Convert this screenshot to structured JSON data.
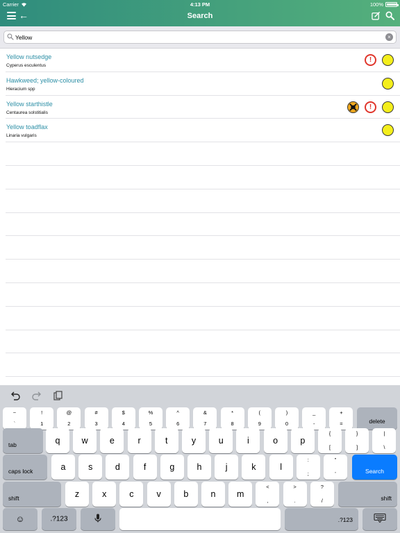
{
  "status": {
    "carrier": "Carrier",
    "time": "4:13 PM",
    "battery": "100%",
    "battery_level": 1.0
  },
  "nav": {
    "title": "Search",
    "menu_icon": "list-icon",
    "back_icon": "arrow-left-icon",
    "compose_icon": "compose-icon",
    "search_icon": "search-icon"
  },
  "search": {
    "value": "Yellow",
    "placeholder": ""
  },
  "results": [
    {
      "name": "Yellow nutsedge",
      "scientific": "Cyperus esculentus",
      "icons": [
        "alert",
        "yellow-dot"
      ]
    },
    {
      "name": "Hawkweed; yellow-coloured",
      "scientific": "Hieracium spp",
      "icons": [
        "yellow-dot"
      ]
    },
    {
      "name": "Yellow starthistle",
      "scientific": "Centaurea solstitialis",
      "icons": [
        "toxic",
        "alert",
        "yellow-dot"
      ]
    },
    {
      "name": "Yellow toadflax",
      "scientific": "Linaria vulgaris",
      "icons": [
        "yellow-dot"
      ]
    }
  ],
  "keyboard": {
    "row1": [
      {
        "top": "~",
        "bot": "`"
      },
      {
        "top": "!",
        "bot": "1"
      },
      {
        "top": "@",
        "bot": "2"
      },
      {
        "top": "#",
        "bot": "3"
      },
      {
        "top": "$",
        "bot": "4"
      },
      {
        "top": "%",
        "bot": "5"
      },
      {
        "top": "^",
        "bot": "6"
      },
      {
        "top": "&",
        "bot": "7"
      },
      {
        "top": "*",
        "bot": "8"
      },
      {
        "top": "(",
        "bot": "9"
      },
      {
        "top": ")",
        "bot": "0"
      },
      {
        "top": "_",
        "bot": "-"
      },
      {
        "top": "+",
        "bot": "="
      }
    ],
    "delete": "delete",
    "tab": "tab",
    "row2": [
      "q",
      "w",
      "e",
      "r",
      "t",
      "y",
      "u",
      "i",
      "o",
      "p"
    ],
    "row2_sym": [
      {
        "top": "{",
        "bot": "["
      },
      {
        "top": "}",
        "bot": "]"
      },
      {
        "top": "|",
        "bot": "\\"
      }
    ],
    "caps": "caps lock",
    "row3": [
      "a",
      "s",
      "d",
      "f",
      "g",
      "h",
      "j",
      "k",
      "l"
    ],
    "row3_sym": [
      {
        "top": ":",
        "bot": ";"
      },
      {
        "top": "”",
        "bot": "’"
      }
    ],
    "search_key": "Search",
    "shift": "shift",
    "row4": [
      "z",
      "x",
      "c",
      "v",
      "b",
      "n",
      "m"
    ],
    "row4_sym": [
      {
        "top": "<",
        "bot": ","
      },
      {
        "top": ">",
        "bot": "."
      },
      {
        "top": "?",
        "bot": "/"
      }
    ],
    "numbers": ".?123",
    "emoji_icon": "emoji-icon",
    "mic_icon": "microphone-icon",
    "hide_icon": "keyboard-hide-icon"
  }
}
